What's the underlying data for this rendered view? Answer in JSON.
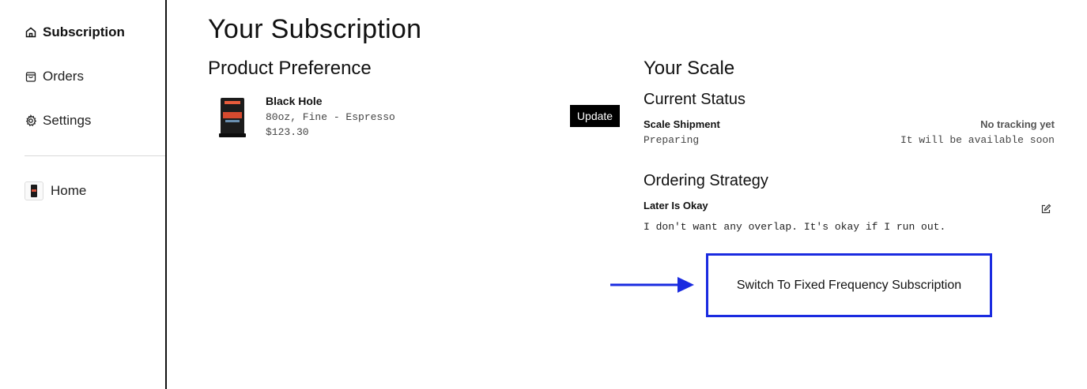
{
  "sidebar": {
    "items": [
      {
        "label": "Subscription",
        "icon": "home-icon",
        "active": true
      },
      {
        "label": "Orders",
        "icon": "bag-icon",
        "active": false
      },
      {
        "label": "Settings",
        "icon": "gear-icon",
        "active": false
      }
    ],
    "home": {
      "label": "Home",
      "icon": "product-thumbnail"
    }
  },
  "page": {
    "title": "Your Subscription"
  },
  "product_preference": {
    "title": "Product Preference",
    "product": {
      "name": "Black Hole",
      "description": "80oz, Fine - Espresso",
      "price": "$123.30"
    },
    "update_label": "Update"
  },
  "scale": {
    "title": "Your Scale",
    "current_status": {
      "title": "Current Status",
      "shipment_label": "Scale Shipment",
      "shipment_state": "Preparing",
      "tracking_label": "No tracking yet",
      "tracking_note": "It will be available soon"
    },
    "ordering_strategy": {
      "title": "Ordering Strategy",
      "name": "Later Is Okay",
      "description": "I don't want any overlap. It's okay if I run out.",
      "edit_icon": "edit-icon"
    },
    "switch_label": "Switch To Fixed Frequency Subscription"
  },
  "colors": {
    "highlight": "#1a2be0",
    "button_bg": "#000000"
  }
}
